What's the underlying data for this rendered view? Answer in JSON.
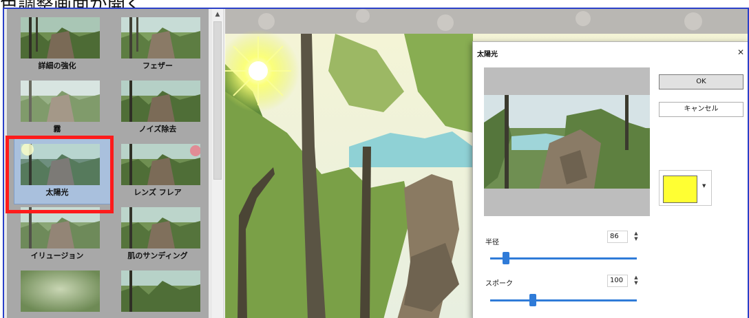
{
  "caption": {
    "text": "色調整画面が開く"
  },
  "gallery": {
    "effects": [
      {
        "label": "詳細の強化"
      },
      {
        "label": "フェザー"
      },
      {
        "label": "霧"
      },
      {
        "label": "ノイズ除去"
      },
      {
        "label": "太陽光"
      },
      {
        "label": "レンズ フレア"
      },
      {
        "label": "イリュージョン"
      },
      {
        "label": "肌のサンディング"
      },
      {
        "label": ""
      },
      {
        "label": ""
      }
    ],
    "selected": "太陽光"
  },
  "dialog": {
    "title": "太陽光",
    "close_icon": "close-icon",
    "ok_label": "OK",
    "cancel_label": "キャンセル",
    "color": "#ffff33",
    "radius_label": "半径",
    "radius_value": "86",
    "radius_level": 0.11,
    "spoke_label": "スポーク",
    "spoke_value": "100",
    "spoke_level": 0.29
  },
  "colors": {
    "window_border": "#2a3fc8",
    "highlight": "#ff1b1b",
    "slider": "#2f7bd8"
  }
}
